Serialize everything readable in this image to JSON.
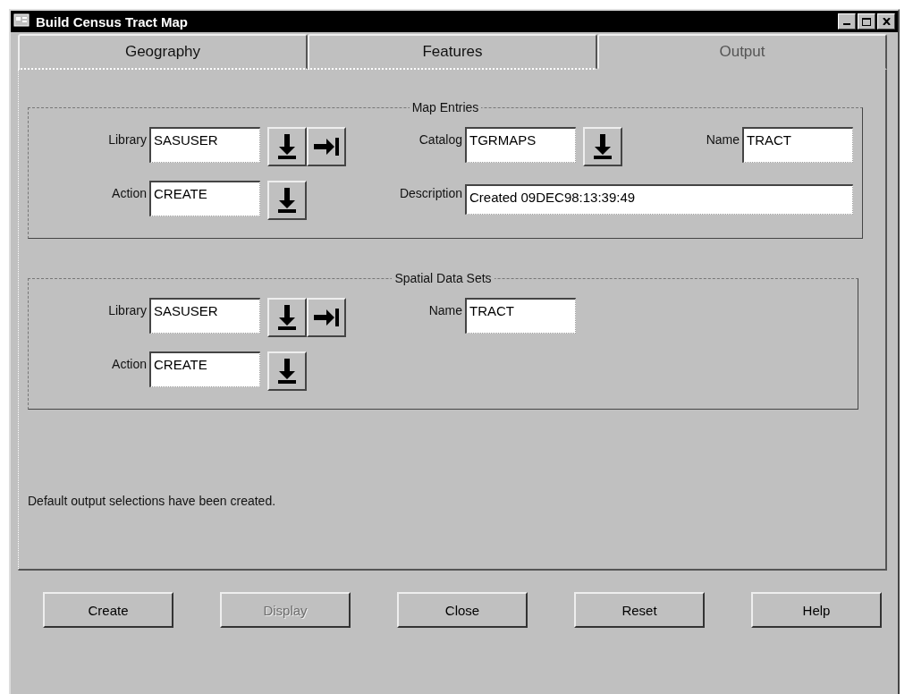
{
  "window": {
    "title": "Build Census Tract Map"
  },
  "tabs": [
    {
      "label": "Geography",
      "selected": false
    },
    {
      "label": "Features",
      "selected": false
    },
    {
      "label": "Output",
      "selected": true
    }
  ],
  "groups": [
    {
      "title": "Map Entries",
      "rows": [
        [
          {
            "label": "Library",
            "value": "SASUSER",
            "buttons": [
              {
                "kind": "dropdown"
              },
              {
                "kind": "browse"
              }
            ]
          },
          {
            "label": "Catalog",
            "value": "TGRMAPS",
            "buttons": [
              {
                "kind": "dropdown"
              }
            ]
          },
          {
            "label": "Name",
            "value": "TRACT"
          }
        ],
        [
          {
            "label": "Action",
            "value": "CREATE",
            "buttons": [
              {
                "kind": "dropdown"
              }
            ]
          },
          {
            "label": "Description",
            "value": "Created 09DEC98:13:39:49"
          }
        ]
      ]
    },
    {
      "title": "Spatial Data Sets",
      "rows": [
        [
          {
            "label": "Library",
            "value": "SASUSER",
            "buttons": [
              {
                "kind": "dropdown"
              },
              {
                "kind": "browse"
              }
            ]
          },
          {
            "label": "Name",
            "value": "TRACT"
          }
        ],
        [
          {
            "label": "Action",
            "value": "CREATE",
            "buttons": [
              {
                "kind": "dropdown"
              }
            ]
          }
        ]
      ]
    }
  ],
  "status": "Default output selections have been created.",
  "buttons": [
    {
      "label": "Create",
      "disabled": false
    },
    {
      "label": "Display",
      "disabled": true
    },
    {
      "label": "Close",
      "disabled": false
    },
    {
      "label": "Reset",
      "disabled": false
    },
    {
      "label": "Help",
      "disabled": false
    }
  ]
}
